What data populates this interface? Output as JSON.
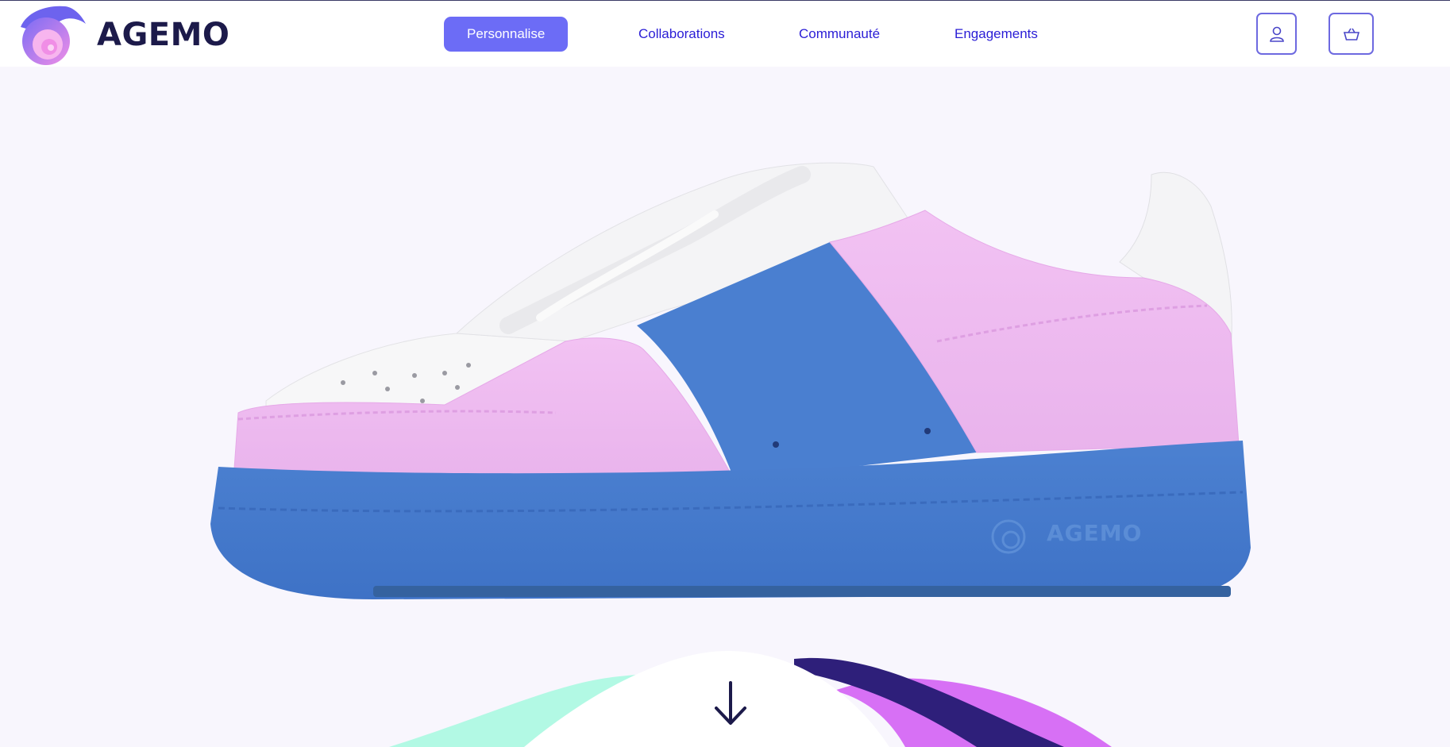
{
  "brand": {
    "name": "AGEMO"
  },
  "nav": {
    "items": [
      {
        "label": "Personnalise",
        "active": true
      },
      {
        "label": "Collaborations",
        "active": false
      },
      {
        "label": "Communauté",
        "active": false
      },
      {
        "label": "Engagements",
        "active": false
      }
    ]
  },
  "header_icons": [
    "user-icon",
    "basket-icon"
  ],
  "hero": {
    "sole_logo_text": "AGEMO",
    "colors": {
      "upper_pink": "#eebcf0",
      "accent_blue": "#4a7fd0",
      "white": "#ffffff"
    }
  },
  "theme": {
    "accent": "#6c6cf6",
    "nav_text": "#2a1dd6",
    "brand_dark": "#1c1a4a",
    "mint": "#b2f9e4",
    "purple": "#d770f5",
    "navy": "#2e1f7a"
  }
}
